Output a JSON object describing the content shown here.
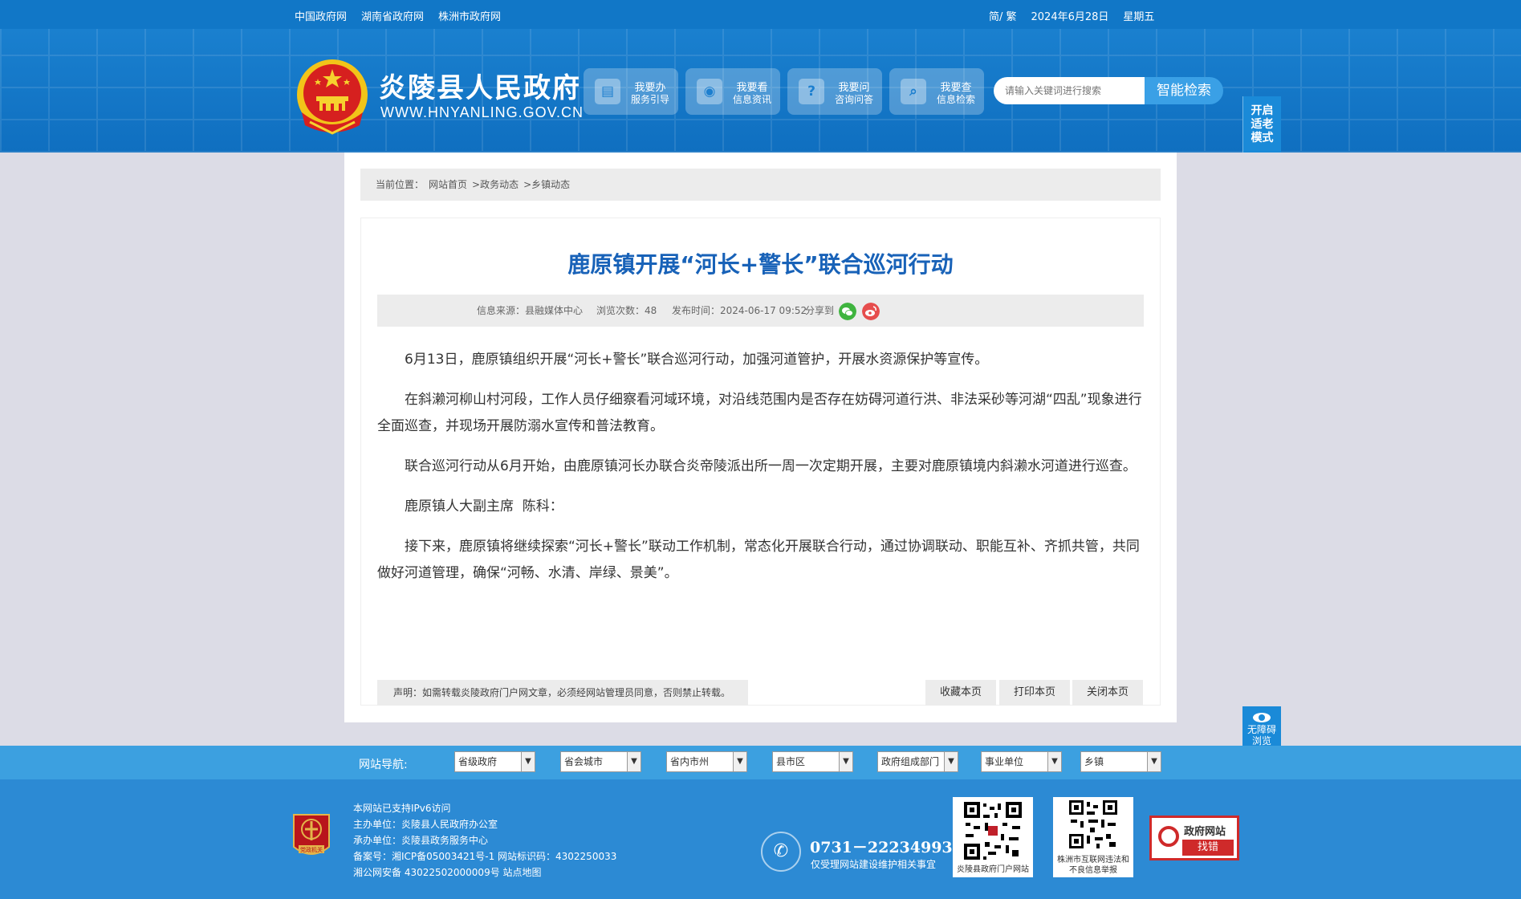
{
  "topbar": {
    "links": [
      "中国政府网",
      "湖南省政府网",
      "株洲市政府网"
    ],
    "lang": "简/ 繁",
    "date": "2024年6月28日",
    "weekday": "星期五"
  },
  "header": {
    "title": "炎陵县人民政府",
    "domain": "WWW.HNYANLING.GOV.CN",
    "nav": [
      {
        "t1": "我要办",
        "t2": "服务引导",
        "icon": "doc-icon"
      },
      {
        "t1": "我要看",
        "t2": "信息资讯",
        "icon": "eye-icon"
      },
      {
        "t1": "我要问",
        "t2": "咨询问答",
        "icon": "question-icon"
      },
      {
        "t1": "我要查",
        "t2": "信息检索",
        "icon": "search-icon"
      }
    ],
    "search_placeholder": "请输入关键词进行搜索",
    "search_button": "智能检索",
    "elder_mode": "开启\n适老\n模式"
  },
  "breadcrumb": {
    "prefix": "当前位置：",
    "items": [
      "网站首页",
      ">政务动态",
      ">乡镇动态"
    ]
  },
  "article": {
    "title": "鹿原镇开展“河长+警长”联合巡河行动",
    "meta": {
      "source": "信息来源：县融媒体中心",
      "views": "浏览次数：48",
      "time": "发布时间：2024-06-17 09:52",
      "share": "分享到"
    },
    "paragraphs": [
      "6月13日，鹿原镇组织开展“河长+警长”联合巡河行动，加强河道管护，开展水资源保护等宣传。",
      "在斜濑河柳山村河段，工作人员仔细察看河域环境，对沿线范围内是否存在妨碍河道行洪、非法采砂等河湖“四乱”现象进行全面巡查，并现场开展防溺水宣传和普法教育。",
      "联合巡河行动从6月开始，由鹿原镇河长办联合炎帝陵派出所一周一次定期开展，主要对鹿原镇境内斜濑水河道进行巡查。",
      "鹿原镇人大副主席  陈科：",
      "接下来，鹿原镇将继续探索“河长+警长”联动工作机制，常态化开展联合行动，通过协调联动、职能互补、齐抓共管，共同做好河道管理，确保“河畅、水清、岸绿、景美”。"
    ],
    "declaration": "声明：如需转载炎陵政府门户网文章，必须经网站管理员同意，否则禁止转载。",
    "actions": [
      "收藏本页",
      "打印本页",
      "关闭本页"
    ]
  },
  "accessibility": "无障碍\n浏览",
  "sitenav": {
    "label": "网站导航:",
    "selects": [
      "省级政府",
      "省会城市",
      "省内市州",
      "县市区",
      "政府组成部门",
      "事业单位",
      "乡镇"
    ]
  },
  "footer": {
    "badge": "党政机关",
    "lines": [
      "本网站已支持IPv6访问",
      "主办单位：炎陵县人民政府办公室",
      "承办单位：炎陵县政务服务中心",
      "备案号：湘ICP备05003421号-1 网站标识码：4302250033",
      "湘公网安备 43022502000009号 站点地图"
    ],
    "phone": "0731－22234993",
    "phone_note": "仅受理网站建设维护相关事宜",
    "qr1_caption": "炎陵县政府门户网站",
    "qr2_caption": "株洲市互联网违法和不良信息举报",
    "findbug_top": "政府网站",
    "findbug_bottom": "找错"
  },
  "colors": {
    "header_blue": "#1177c7",
    "title_blue": "#1862b8",
    "nav_bar": "#3ca0e0",
    "footer": "#2c8ad4"
  }
}
